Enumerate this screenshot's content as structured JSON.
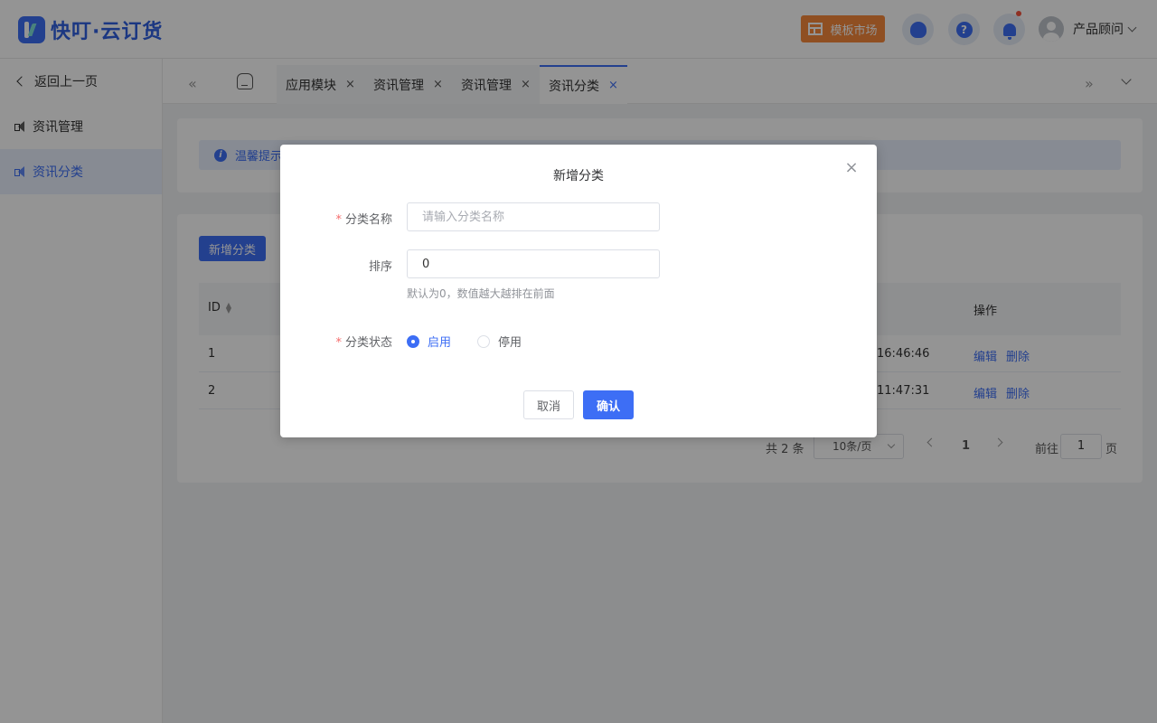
{
  "app": {
    "logo_text": "快叮·云订货"
  },
  "header": {
    "market_label": "模板市场",
    "help_glyph": "?",
    "user_name": "产品顾问"
  },
  "sidebar": {
    "back_label": "返回上一页",
    "items": [
      {
        "label": "资讯管理",
        "active": false
      },
      {
        "label": "资讯分类",
        "active": true
      }
    ]
  },
  "tabs": {
    "items": [
      {
        "label": "应用模块",
        "active": false
      },
      {
        "label": "资讯管理",
        "active": false
      },
      {
        "label": "资讯管理",
        "active": false
      },
      {
        "label": "资讯分类",
        "active": true
      }
    ],
    "close_glyph": "×",
    "left_glyph": "«",
    "right_glyph": "»"
  },
  "main": {
    "tip_text": "温馨提示",
    "add_button": "新增分类",
    "table": {
      "headers": {
        "id": "ID",
        "actions": "操作"
      },
      "rows": [
        {
          "id": "1",
          "time_suffix": "16:46:46",
          "edit": "编辑",
          "delete": "删除"
        },
        {
          "id": "2",
          "time_suffix": "11:47:31",
          "edit": "编辑",
          "delete": "删除"
        }
      ]
    },
    "pagination": {
      "total": "共 2 条",
      "page_size": "10条/页",
      "current_page": "1",
      "goto_label": "前往",
      "goto_value": "1",
      "page_unit": "页"
    }
  },
  "modal": {
    "title": "新增分类",
    "close_glyph": "×",
    "fields": {
      "name_label": "分类名称",
      "name_placeholder": "请输入分类名称",
      "sort_label": "排序",
      "sort_value": "0",
      "sort_hint": "默认为0，数值越大越排在前面",
      "status_label": "分类状态",
      "status_options": [
        "启用",
        "停用"
      ],
      "status_selected": "启用",
      "required_mark": "*"
    },
    "cancel_label": "取消",
    "confirm_label": "确认"
  },
  "colors": {
    "accent": "#3d6ef5",
    "market": "#f6893b",
    "required": "#f56c6c",
    "overlay": "rgba(0,0,0,0.42)"
  }
}
